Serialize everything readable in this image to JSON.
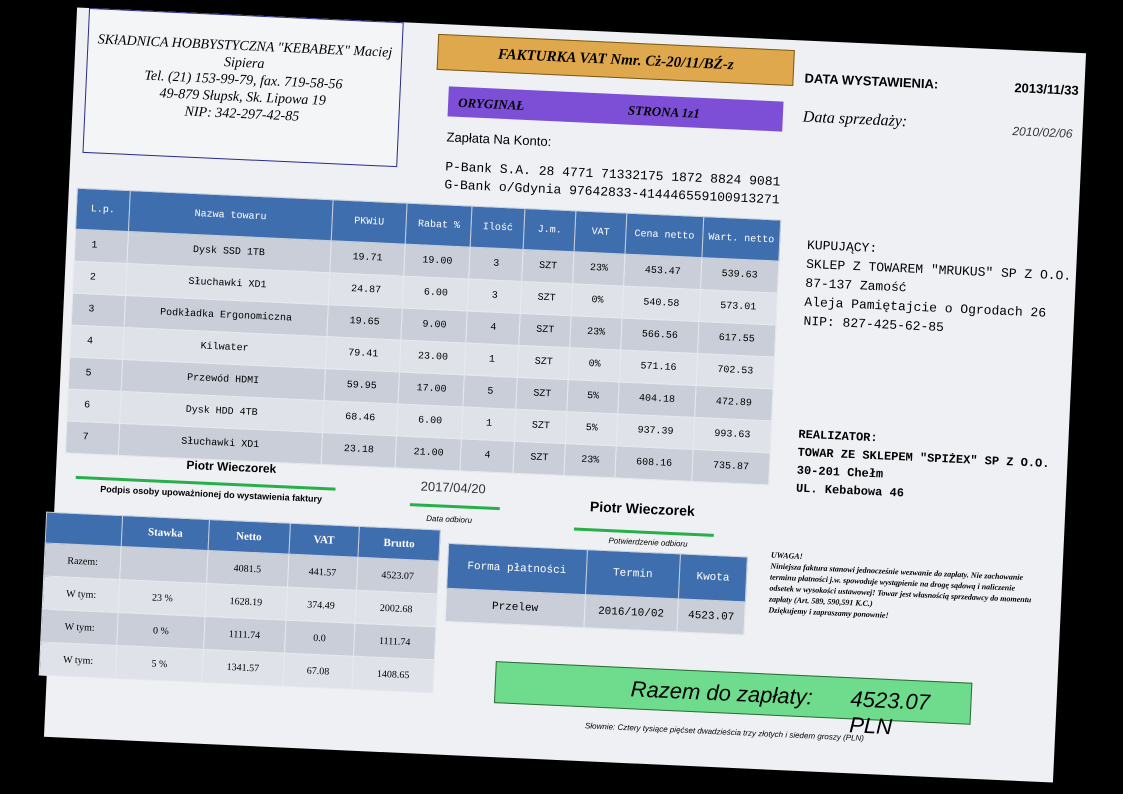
{
  "seller": {
    "line1": "SKłADNICA HOBBYSTYCZNA \"KEBABEX\" Maciej Sipiera",
    "phone": "Tel. (21) 153-99-79, fax. 719-58-56",
    "address": "49-879 Słupsk, Sk. Lipowa 19",
    "nip": "NIP: 342-297-42-85"
  },
  "title": "FAKTURKA VAT Nmr. Cż-20/11/BŹ-z",
  "original_label": "ORYGINAŁ",
  "page_label": "STRONA 1z1",
  "issue_date_label": "DATA WYSTAWIENIA:",
  "issue_date": "2013/11/33",
  "sale_date_label": "Data sprzedaży:",
  "sale_date": "2010/02/06",
  "payment_account_label": "Zapłata Na Konto:",
  "bank1": "P-Bank S.A. 28 4771 71332175 1872 8824 9081",
  "bank2": "G-Bank  o/Gdynia 97642833-414446559100913271",
  "items_headers": [
    "L.p.",
    "Nazwa towaru",
    "PKWiU",
    "Rabat %",
    "Ilość",
    "J.m.",
    "VAT",
    "Cena netto",
    "Wart. netto"
  ],
  "items": [
    [
      "1",
      "Dysk SSD 1TB",
      "19.71",
      "19.00",
      "3",
      "SZT",
      "23%",
      "453.47",
      "539.63"
    ],
    [
      "2",
      "Słuchawki XD1",
      "24.87",
      "6.00",
      "3",
      "SZT",
      "0%",
      "540.58",
      "573.01"
    ],
    [
      "3",
      "Podkładka Ergonomiczna",
      "19.65",
      "9.00",
      "4",
      "SZT",
      "23%",
      "566.56",
      "617.55"
    ],
    [
      "4",
      "Kilwater",
      "79.41",
      "23.00",
      "1",
      "SZT",
      "0%",
      "571.16",
      "702.53"
    ],
    [
      "5",
      "Przewód HDMI",
      "59.95",
      "17.00",
      "5",
      "SZT",
      "5%",
      "404.18",
      "472.89"
    ],
    [
      "6",
      "Dysk HDD 4TB",
      "68.46",
      "6.00",
      "1",
      "SZT",
      "5%",
      "937.39",
      "993.63"
    ],
    [
      "7",
      "Słuchawki XD1",
      "23.18",
      "21.00",
      "4",
      "SZT",
      "23%",
      "608.16",
      "735.87"
    ]
  ],
  "buyer": {
    "label": "KUPUJĄCY:",
    "name": "SKLEP Z TOWAREM \"MRUKUS\" SP Z O.O.",
    "city": "87-137 Zamość",
    "street": "Aleja Pamiętajcie o Ogrodach 26",
    "nip": "NIP: 827-425-62-85"
  },
  "realizer": {
    "label": "REALIZATOR:",
    "name": "TOWAR ZE SKLEPEM \"SPIŻEX\" SP Z O.O.",
    "city": "30-201 Chełm",
    "street": "UL. Kebabowa 46"
  },
  "signer_name": "Piotr Wieczorek",
  "signer_caption": "Podpis osoby upoważnionej do wystawienia faktury",
  "receipt_date": "2017/04/20",
  "receipt_date_caption": "Data odbioru",
  "receiver_name": "Piotr Wieczorek",
  "receiver_caption": "Potwierdzenie odbioru",
  "summary_headers": [
    "",
    "Stawka",
    "Netto",
    "VAT",
    "Brutto"
  ],
  "summary_rows": [
    [
      "Razem:",
      "",
      "4081.5",
      "441.57",
      "4523.07"
    ],
    [
      "W tym:",
      "23 %",
      "1628.19",
      "374.49",
      "2002.68"
    ],
    [
      "W tym:",
      "0 %",
      "1111.74",
      "0.0",
      "1111.74"
    ],
    [
      "W tym:",
      "5 %",
      "1341.57",
      "67.08",
      "1408.65"
    ]
  ],
  "payment_headers": [
    "Forma płatności",
    "Termin",
    "Kwota"
  ],
  "payment_row": [
    "Przelew",
    "2016/10/02",
    "4523.07"
  ],
  "notice_title": "UWAGA!",
  "notice_body": "Niniejsza faktura stanowi jednocześnie wezwanie do zapłaty. Nie zachowanie terminu płatności j.w. spowoduje wystąpienie na drogę sądową i naliczenie odsetek w wysokości ustawowej! Towar jest własnością sprzedawcy do momentu zapłaty (Art. 589, 590,591 K.C.)",
  "notice_thanks": "Dziękujemy i zapraszamy ponownie!",
  "total_label": "Razem do zapłaty:",
  "total_value": "4523.07 PLN",
  "words": "Słownie: Cztery tysiące pięćset dwadzieścia trzy złotych i siedem groszy (PLN)"
}
